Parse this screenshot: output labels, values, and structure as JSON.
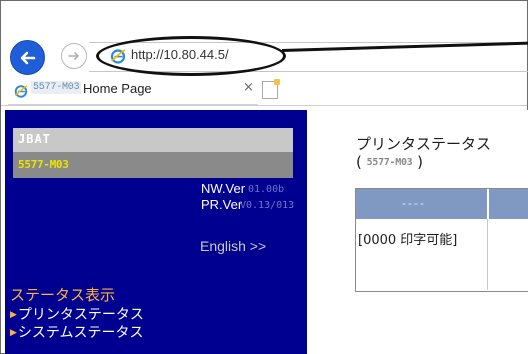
{
  "browser": {
    "url": "http://10.80.44.5/",
    "tab": {
      "model_label": "5577-M03",
      "title": "Home Page",
      "close_glyph": "×"
    },
    "back_icon": "arrow-left-icon",
    "forward_icon": "arrow-right-icon"
  },
  "sidebar": {
    "brand": "JBAT",
    "model": "5577-M03",
    "versions": [
      {
        "label": "NW.Ver",
        "value": "01.00b"
      },
      {
        "label": "PR.Ver",
        "value": "V0.13/013"
      }
    ],
    "english_link": "English >>",
    "status_heading": "ステータス表示",
    "menu": [
      {
        "label": "プリンタステータス"
      },
      {
        "label": "システムステータス"
      }
    ]
  },
  "main": {
    "title": "プリンタステータス",
    "subtitle_open": "( ",
    "subtitle_model": "5577-M03",
    "subtitle_close": " )",
    "table": {
      "header": "----",
      "row": "[0000 印字可能]"
    }
  },
  "colors": {
    "sidebar_bg": "#000090",
    "accent_orange": "#ffb040",
    "model_yellow": "#e9e400",
    "table_header": "#7f99c2",
    "back_button": "#1f5ed8"
  }
}
